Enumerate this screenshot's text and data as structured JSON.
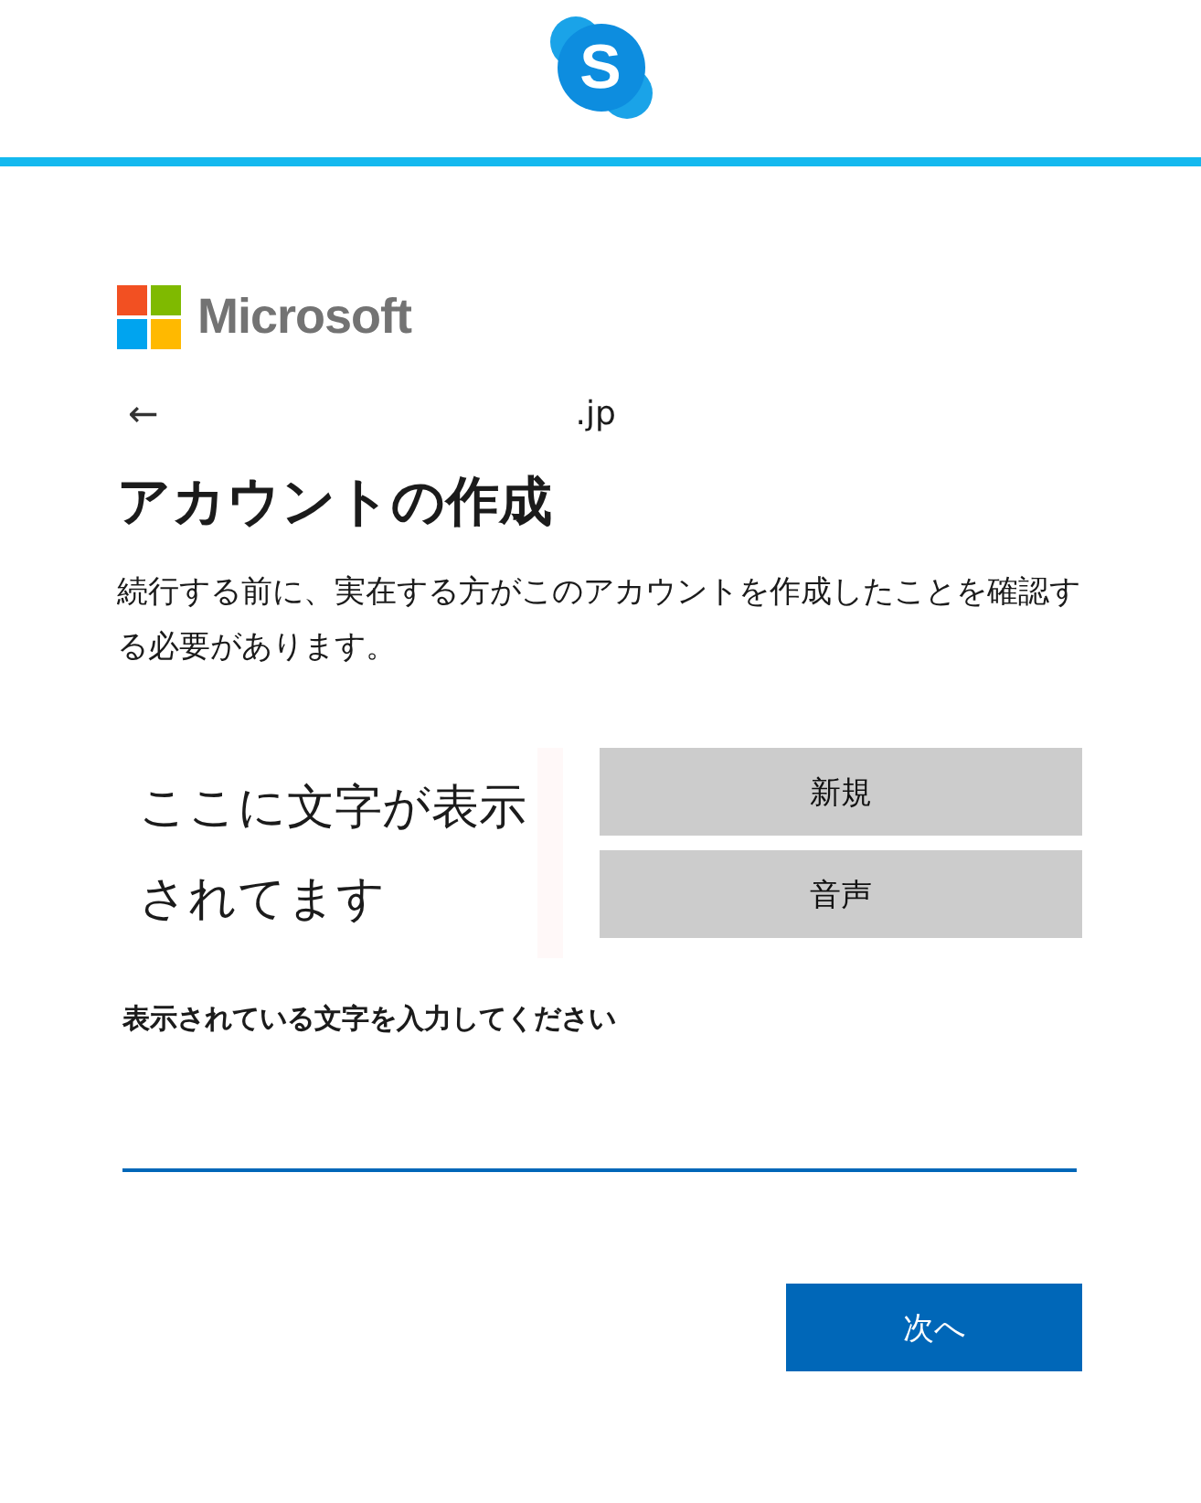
{
  "app_logo": {
    "letter": "S"
  },
  "brand": {
    "name": "Microsoft"
  },
  "back": {
    "icon": "←",
    "account": ".jp"
  },
  "title": "アカウントの作成",
  "description": "続行する前に、実在する方がこのアカウントを作成したことを確認する必要があります。",
  "captcha": {
    "text": "ここに文字が表示されてます",
    "buttons": [
      "新規",
      "音声"
    ]
  },
  "input": {
    "label": "表示されている文字を入力してください"
  },
  "next_button": "次へ"
}
